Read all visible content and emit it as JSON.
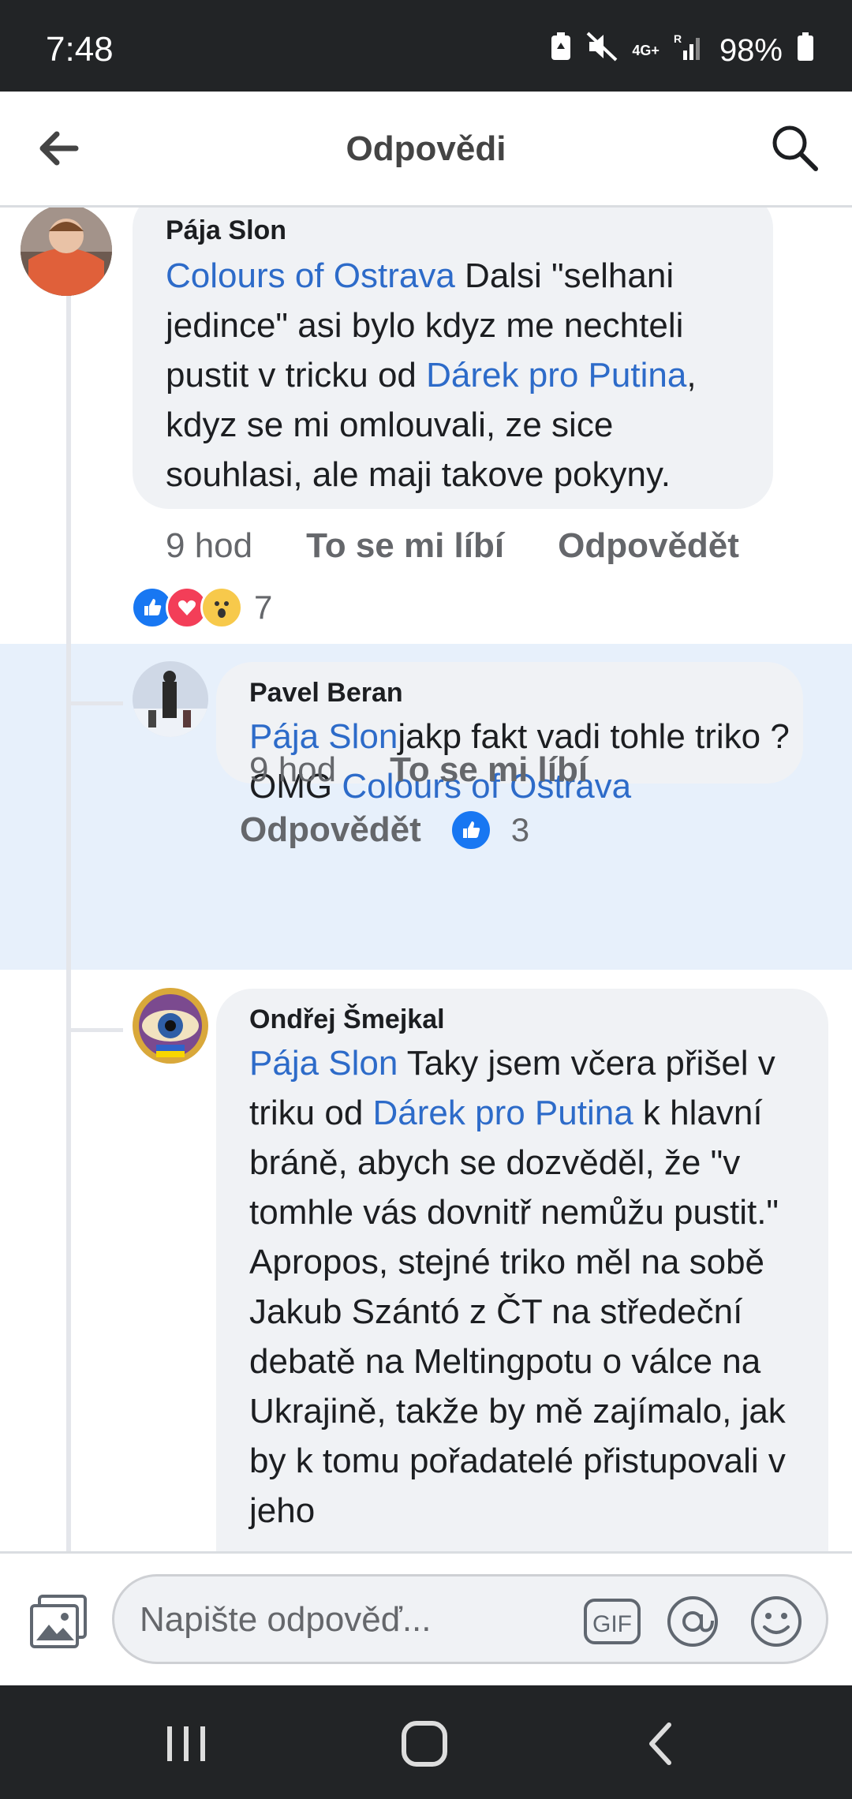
{
  "status_bar": {
    "time": "7:48",
    "network": "4G+",
    "roaming": "R",
    "battery": "98%"
  },
  "header": {
    "title": "Odpovědi",
    "back_icon": "arrow-left-icon",
    "search_icon": "search-icon"
  },
  "comments": [
    {
      "author": "Pája Slon",
      "mention_1": "Colours of Ostrava",
      "text_1": "  Dalsi \"selhani jedince\" asi bylo kdyz me nechteli pustit v tricku od ",
      "mention_2": "Dárek pro Putina",
      "text_2": ", kdyz se mi omlouvali, ze sice souhlasi, ale maji takove pokyny.",
      "time": "9 hod",
      "like_label": "To se mi líbí",
      "reply_label": "Odpovědět",
      "reactions": [
        "like-icon",
        "love-icon",
        "wow-icon"
      ],
      "reaction_count": "7"
    },
    {
      "author": "Pavel Beran",
      "mention_1": "Pája Slon",
      "text_1": "jakp fakt vadi tohle triko ? OMG ",
      "mention_2": "Colours of Ostrava",
      "time": "9 hod",
      "like_label": "To se mi líbí",
      "reply_label": "Odpovědět",
      "reactions": [
        "like-icon"
      ],
      "reaction_count": "3"
    },
    {
      "author": "Ondřej Šmejkal",
      "mention_1": "Pája Slon",
      "text_1": " Taky jsem včera přišel v triku od ",
      "mention_2": "Dárek pro Putina",
      "text_2": " k hlavní bráně, abych se dozvěděl, že \"v tomhle vás dovnitř nemůžu pustit.\" Apropos, stejné triko měl na sobě Jakub Szántó z ČT na středeční debatě na Meltingpotu o válce na Ukrajině, takže by mě zajímalo, jak by k tomu pořadatelé přistupovali v jeho"
    }
  ],
  "composer": {
    "placeholder": "Napište odpověď...",
    "gif_label": "GIF",
    "gallery_icon": "gallery-icon",
    "mention_icon": "at-sign-icon",
    "emoji_icon": "emoji-icon"
  },
  "nav_bar": {
    "recents_icon": "recents-icon",
    "home_icon": "home-icon",
    "back_icon": "nav-back-icon"
  },
  "colors": {
    "mention": "#2d6bc9",
    "highlight": "#e7f0fb",
    "bubble": "#f0f2f5",
    "bars": "#222426"
  }
}
